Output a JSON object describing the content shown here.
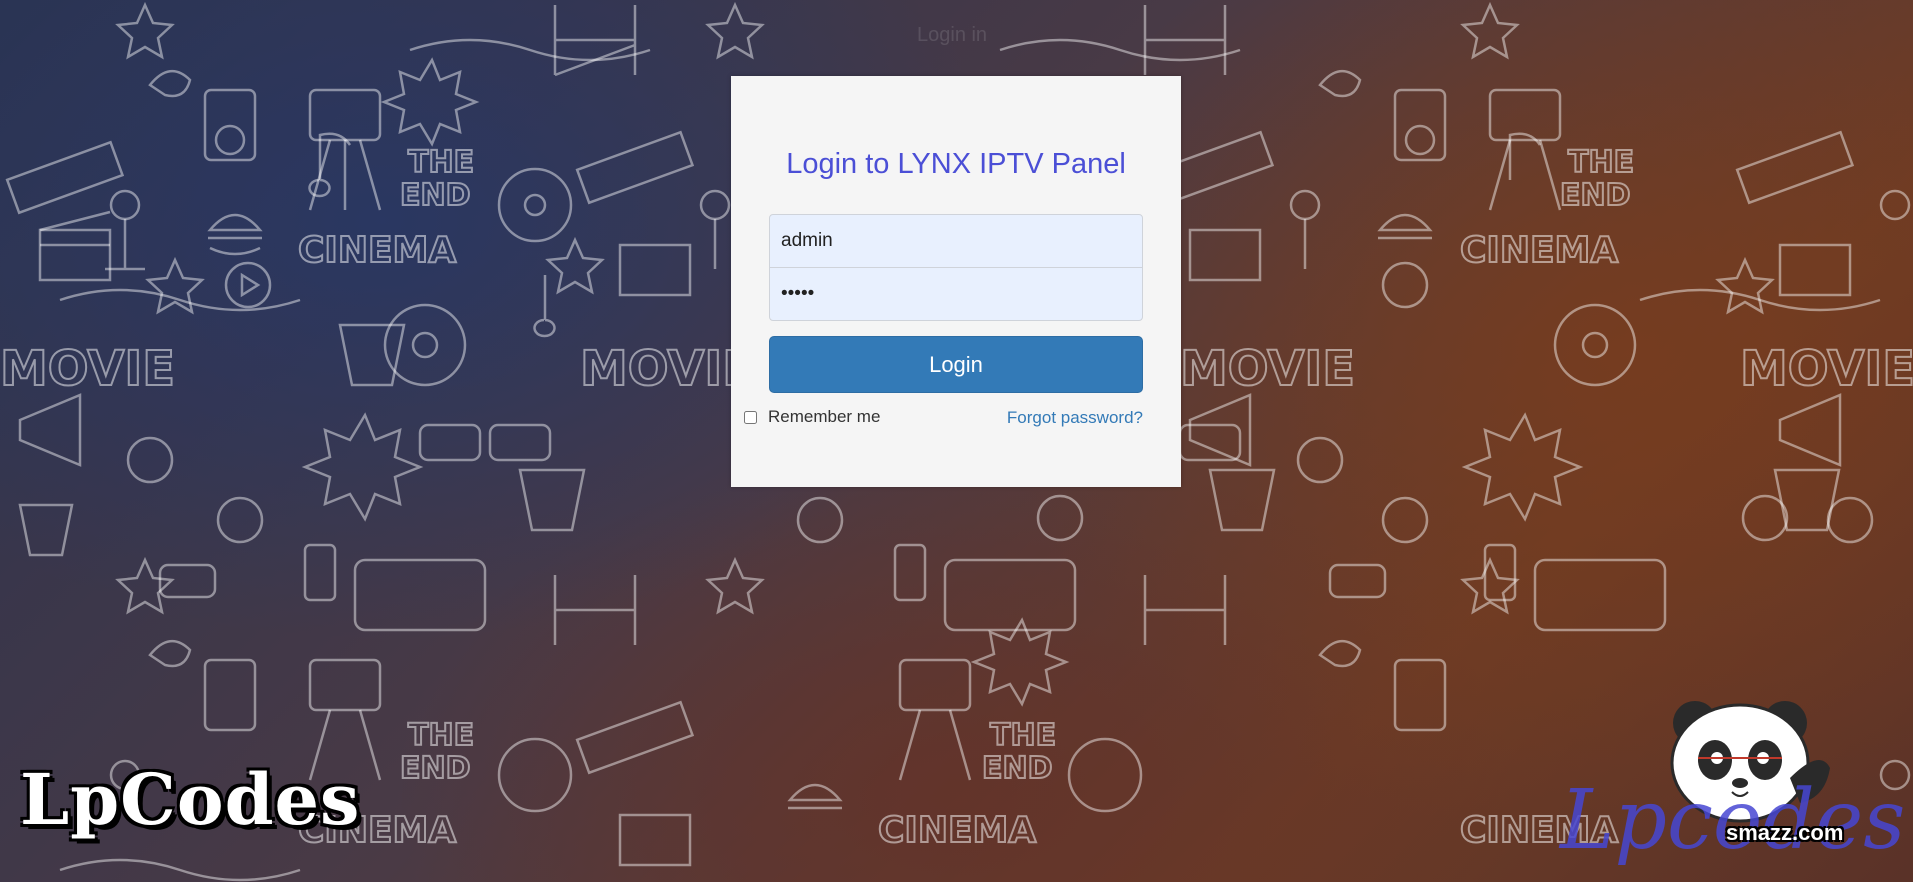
{
  "background": {
    "faint_text": "Login in"
  },
  "login": {
    "title": "Login to LYNX IPTV Panel",
    "username_value": "admin",
    "password_value": "•••••",
    "submit_label": "Login",
    "remember_label": "Remember me",
    "forgot_label": "Forgot password?"
  },
  "watermarks": {
    "left_logo": "LpCodes",
    "right_logo": "Lpcodes",
    "right_small": "smazz.com"
  },
  "colors": {
    "title": "#4b4fd6",
    "button": "#337ab7",
    "link": "#337ab7",
    "card": "#f5f5f5"
  }
}
